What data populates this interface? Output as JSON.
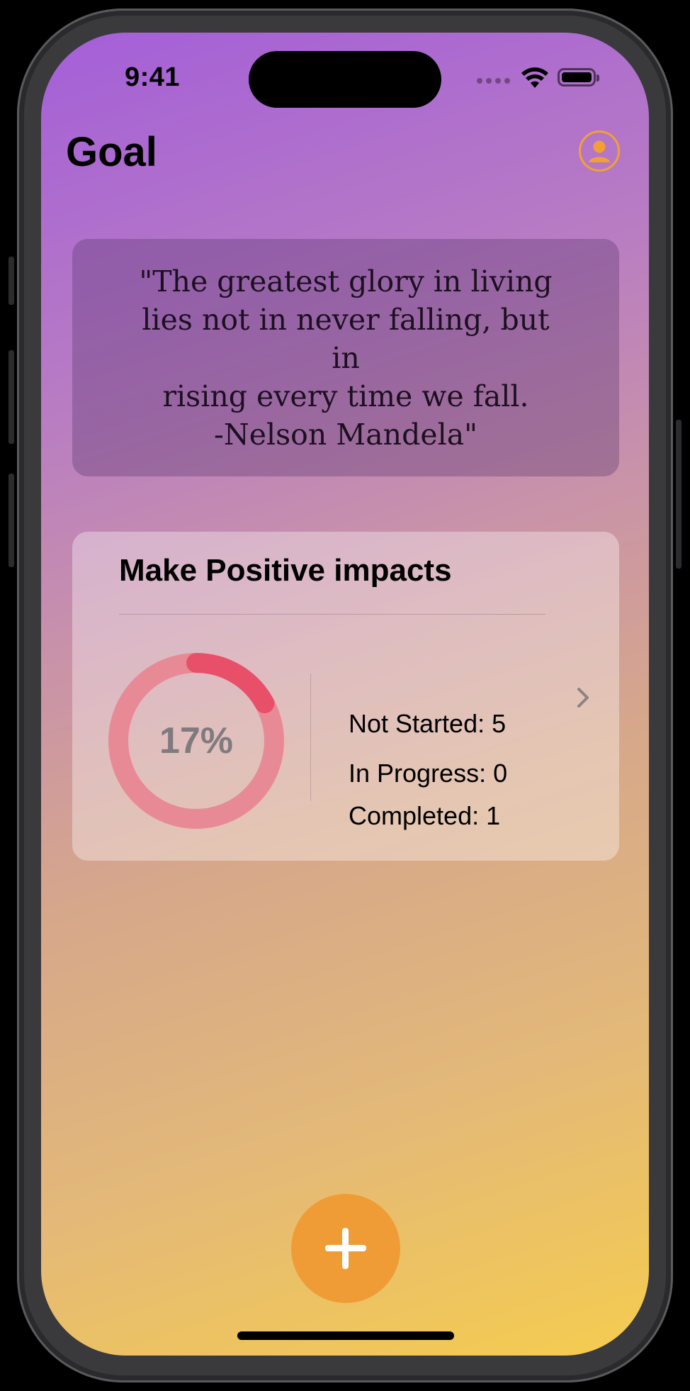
{
  "status_bar": {
    "time": "9:41"
  },
  "header": {
    "title": "Goal",
    "profile_icon": "person-circle-icon",
    "accent_color": "#f2a036"
  },
  "quote": {
    "text": "\"The greatest glory in living\nlies not in never falling, but in\nrising every time we fall.\n-Nelson Mandela\""
  },
  "goal_card": {
    "title": "Make Positive impacts",
    "progress_label": "17%",
    "progress_fraction": 0.17,
    "ring_track_color": "#e88a96",
    "ring_fill_color": "#e8506a",
    "stats": {
      "not_started": "Not Started: 5",
      "in_progress": "In Progress: 0",
      "completed": "Completed: 1"
    },
    "chevron_icon": "chevron-right-icon"
  },
  "fab": {
    "icon": "plus-icon",
    "color": "#f09c36"
  }
}
